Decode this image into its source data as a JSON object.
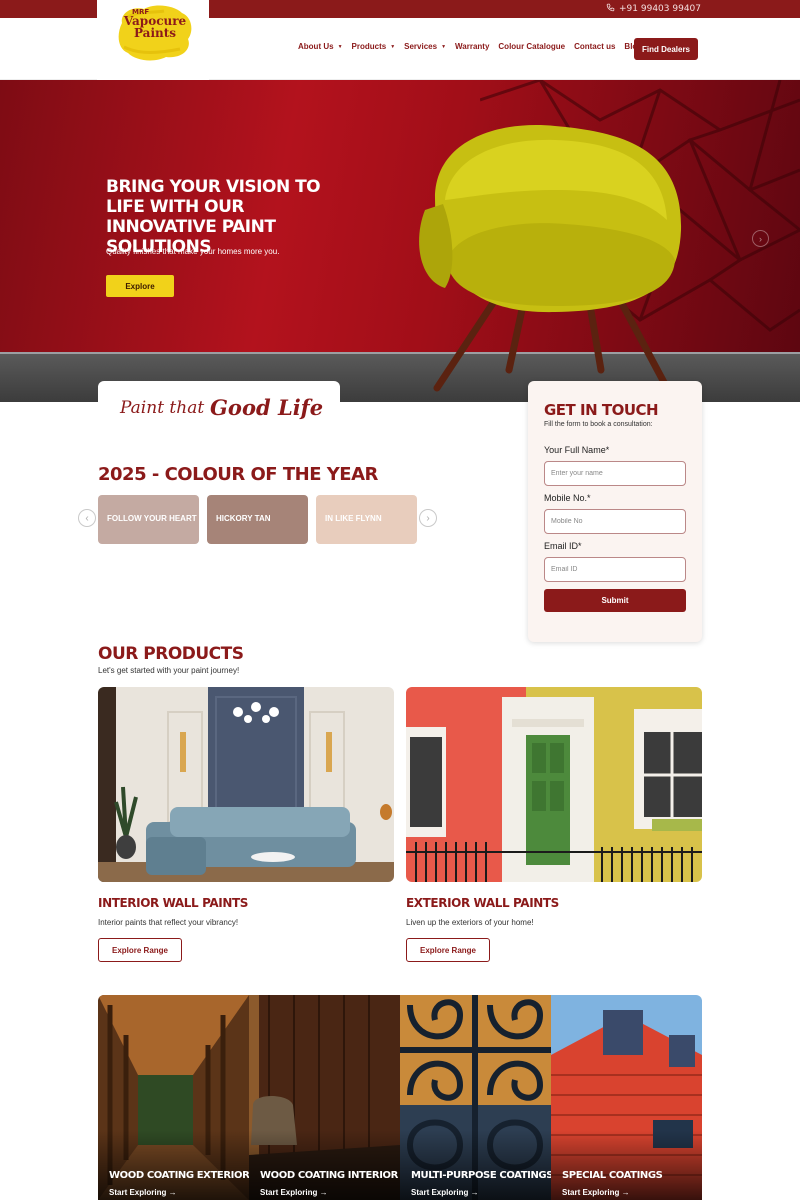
{
  "topbar": {
    "phone": "+91 99403 99407"
  },
  "logo": {
    "small": "MRF",
    "line1": "Vapocure",
    "line2": "Paints"
  },
  "nav": [
    {
      "label": "About Us",
      "caret": "▼"
    },
    {
      "label": "Products",
      "caret": "▼"
    },
    {
      "label": "Services",
      "caret": "▼"
    },
    {
      "label": "Warranty"
    },
    {
      "label": "Colour Catalogue"
    },
    {
      "label": "Contact us"
    },
    {
      "label": "Blog"
    }
  ],
  "header": {
    "cta": "Find Dealers"
  },
  "hero": {
    "title": "BRING YOUR VISION TO LIFE WITH OUR INNOVATIVE PAINT SOLUTIONS",
    "subtitle": "Quality finishes that make your homes more you.",
    "button": "Explore",
    "next": "›"
  },
  "tagline": {
    "part1": "Paint that",
    "part2": "Good Life"
  },
  "colour_of_year": {
    "title": "2025 - COLOUR OF THE YEAR",
    "prev": "‹",
    "next": "›",
    "swatches": [
      {
        "label": "FOLLOW YOUR HEART",
        "color": "#c4aaa2"
      },
      {
        "label": "HICKORY TAN",
        "color": "#a68478"
      },
      {
        "label": "IN LIKE FLYNN",
        "color": "#e8cdbd"
      }
    ]
  },
  "contact": {
    "title": "GET IN TOUCH",
    "subtitle": "Fill the form to book a consultation:",
    "name_label": "Your Full Name*",
    "name_placeholder": "Enter your name",
    "mobile_label": "Mobile No.*",
    "mobile_placeholder": "Mobile No",
    "email_label": "Email ID*",
    "email_placeholder": "Email ID",
    "submit": "Submit"
  },
  "products": {
    "title": "OUR PRODUCTS",
    "subtitle": "Let's get started with your paint journey!",
    "items": [
      {
        "title": "INTERIOR WALL PAINTS",
        "desc": "Interior paints that reflect your vibrancy!",
        "button": "Explore Range"
      },
      {
        "title": "EXTERIOR WALL PAINTS",
        "desc": "Liven up the exteriors of your home!",
        "button": "Explore Range"
      }
    ]
  },
  "coatings": [
    {
      "label": "WOOD COATING EXTERIOR",
      "link": "Start Exploring →"
    },
    {
      "label": "WOOD COATING INTERIOR",
      "link": "Start Exploring →"
    },
    {
      "label": "MULTI-PURPOSE COATINGS",
      "link": "Start Exploring →"
    },
    {
      "label": "SPECIAL COATINGS",
      "link": "Start Exploring →"
    }
  ],
  "colors": {
    "brand": "#8b1a1a",
    "accent": "#f1d21a"
  }
}
